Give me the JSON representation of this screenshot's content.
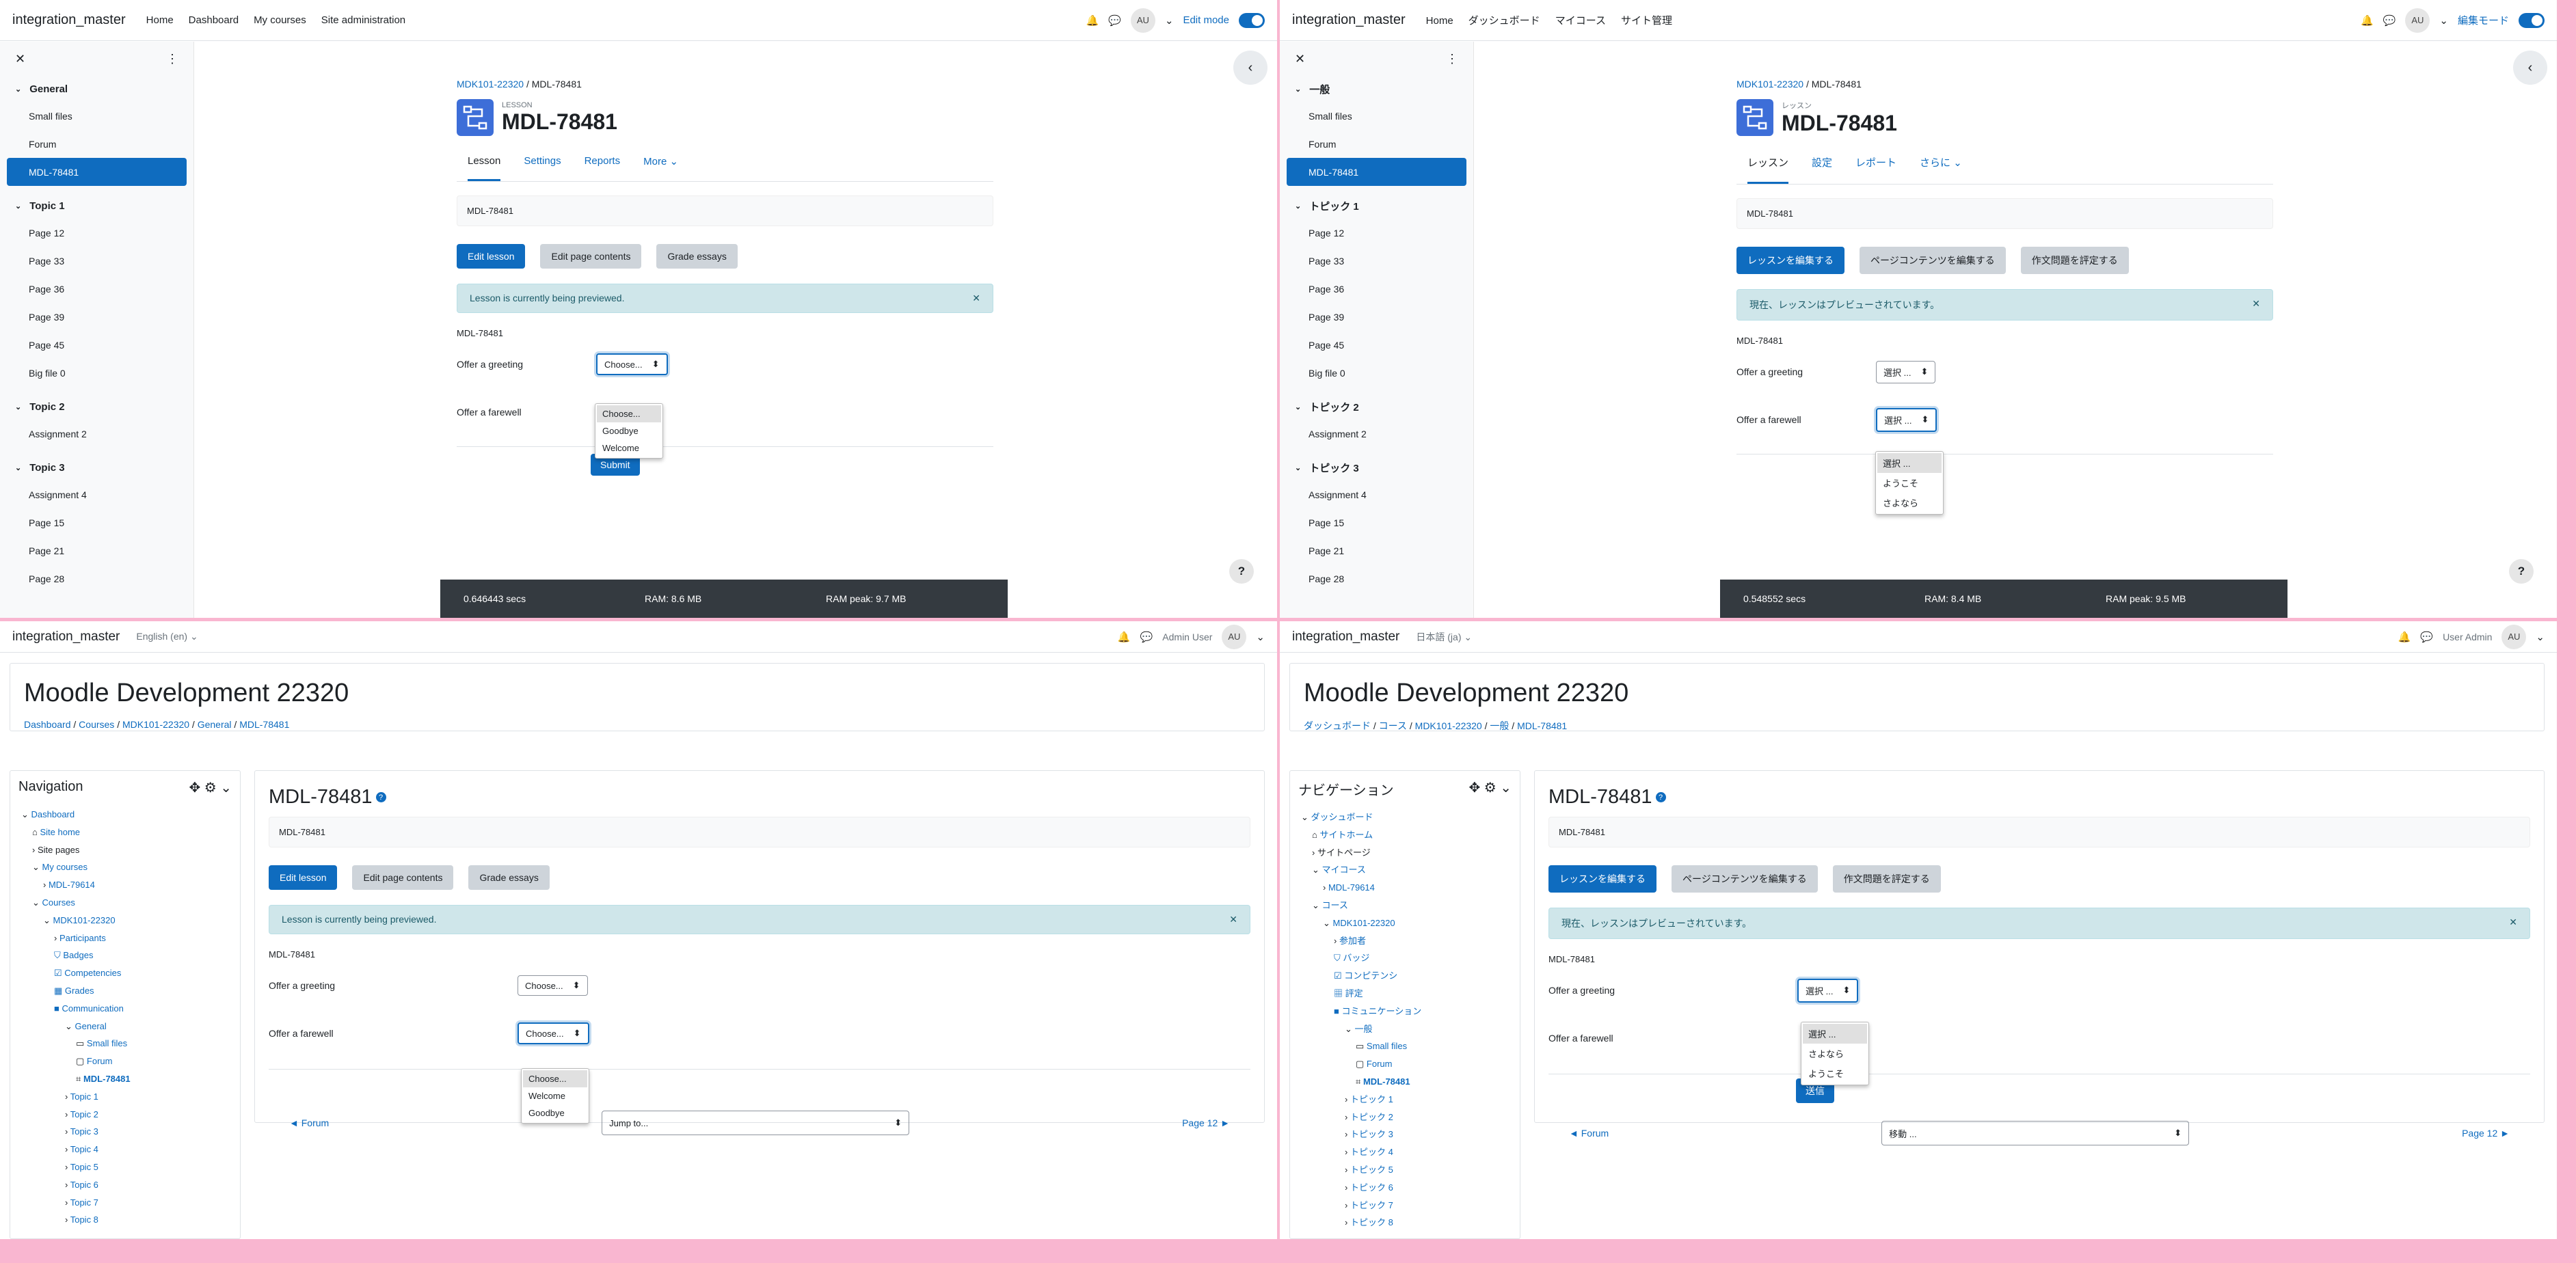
{
  "tl": {
    "brand": "integration_master",
    "nav": [
      "Home",
      "Dashboard",
      "My courses",
      "Site administration"
    ],
    "avatar": "AU",
    "editmode": "Edit mode",
    "drawer": {
      "sections": [
        {
          "title": "General",
          "items": [
            "Small files",
            "Forum",
            "MDL-78481"
          ]
        },
        {
          "title": "Topic 1",
          "items": [
            "Page 12",
            "Page 33",
            "Page 36",
            "Page 39",
            "Page 45",
            "Big file 0"
          ]
        },
        {
          "title": "Topic 2",
          "items": [
            "Assignment 2"
          ]
        },
        {
          "title": "Topic 3",
          "items": [
            "Assignment 4",
            "Page 15",
            "Page 21",
            "Page 28"
          ]
        }
      ],
      "active": "MDL-78481"
    },
    "bc": [
      "MDK101-22320",
      "MDL-78481"
    ],
    "type": "LESSON",
    "title": "MDL-78481",
    "tabs": [
      "Lesson",
      "Settings",
      "Reports",
      "More"
    ],
    "crumb": "MDL-78481",
    "buttons": [
      "Edit lesson",
      "Edit page contents",
      "Grade essays"
    ],
    "alert": "Lesson is currently being previewed.",
    "pagetitle": "MDL-78481",
    "greet": "Offer a greeting",
    "farewell": "Offer a farewell",
    "sel1": "Choose...",
    "sel2": "Choose...",
    "opts": [
      "Choose...",
      "Goodbye",
      "Welcome"
    ],
    "submit": "Submit",
    "perf": [
      "0.646443 secs",
      "RAM: 8.6 MB",
      "RAM peak: 9.7 MB"
    ]
  },
  "tr": {
    "brand": "integration_master",
    "nav": [
      "Home",
      "ダッシュボード",
      "マイコース",
      "サイト管理"
    ],
    "avatar": "AU",
    "editmode": "編集モード",
    "drawer": {
      "sections": [
        {
          "title": "一般",
          "items": [
            "Small files",
            "Forum",
            "MDL-78481"
          ]
        },
        {
          "title": "トピック 1",
          "items": [
            "Page 12",
            "Page 33",
            "Page 36",
            "Page 39",
            "Page 45",
            "Big file 0"
          ]
        },
        {
          "title": "トピック 2",
          "items": [
            "Assignment 2"
          ]
        },
        {
          "title": "トピック 3",
          "items": [
            "Assignment 4",
            "Page 15",
            "Page 21",
            "Page 28"
          ]
        }
      ],
      "active": "MDL-78481"
    },
    "bc": [
      "MDK101-22320",
      "MDL-78481"
    ],
    "type": "レッスン",
    "title": "MDL-78481",
    "tabs": [
      "レッスン",
      "設定",
      "レポート",
      "さらに"
    ],
    "crumb": "MDL-78481",
    "buttons": [
      "レッスンを編集する",
      "ページコンテンツを編集する",
      "作文問題を評定する"
    ],
    "alert": "現在、レッスンはプレビューされています。",
    "pagetitle": "MDL-78481",
    "greet": "Offer a greeting",
    "farewell": "Offer a farewell",
    "sel1": "選択 ...",
    "sel2": "選択 ...",
    "opts": [
      "選択 ...",
      "ようこそ",
      "さよなら"
    ],
    "perf": [
      "0.548552 secs",
      "RAM: 8.4 MB",
      "RAM peak: 9.5 MB"
    ]
  },
  "bl": {
    "brand": "integration_master",
    "lang": "English (en)",
    "user": "Admin User",
    "avatar": "AU",
    "site": "Moodle Development 22320",
    "bc": [
      "Dashboard",
      "Courses",
      "MDK101-22320",
      "General",
      "MDL-78481"
    ],
    "navtitle": "Navigation",
    "tree": [
      "Dashboard",
      "Site home",
      "Site pages",
      "My courses",
      "MDL-79614",
      "Courses",
      "MDK101-22320",
      "Participants",
      "Badges",
      "Competencies",
      "Grades",
      "Communication",
      "General",
      "Small files",
      "Forum",
      "MDL-78481",
      "Topic 1",
      "Topic 2",
      "Topic 3",
      "Topic 4",
      "Topic 5",
      "Topic 6",
      "Topic 7",
      "Topic 8"
    ],
    "title": "MDL-78481",
    "crumb": "MDL-78481",
    "buttons": [
      "Edit lesson",
      "Edit page contents",
      "Grade essays"
    ],
    "alert": "Lesson is currently being previewed.",
    "pagetitle": "MDL-78481",
    "greet": "Offer a greeting",
    "farewell": "Offer a farewell",
    "sel1": "Choose...",
    "sel2": "Choose...",
    "opts": [
      "Choose...",
      "Welcome",
      "Goodbye"
    ],
    "prev": "◄ Forum",
    "jump": "Jump to...",
    "next": "Page 12 ►"
  },
  "br": {
    "brand": "integration_master",
    "lang": "日本語 (ja)",
    "user": "User Admin",
    "avatar": "AU",
    "site": "Moodle Development 22320",
    "bc": [
      "ダッシュボード",
      "コース",
      "MDK101-22320",
      "一般",
      "MDL-78481"
    ],
    "navtitle": "ナビゲーション",
    "tree": [
      "ダッシュボード",
      "サイトホーム",
      "サイトページ",
      "マイコース",
      "MDL-79614",
      "コース",
      "MDK101-22320",
      "参加者",
      "バッジ",
      "コンピテンシ",
      "評定",
      "コミュニケーション",
      "一般",
      "Small files",
      "Forum",
      "MDL-78481",
      "トピック 1",
      "トピック 2",
      "トピック 3",
      "トピック 4",
      "トピック 5",
      "トピック 6",
      "トピック 7",
      "トピック 8"
    ],
    "title": "MDL-78481",
    "crumb": "MDL-78481",
    "buttons": [
      "レッスンを編集する",
      "ページコンテンツを編集する",
      "作文問題を評定する"
    ],
    "alert": "現在、レッスンはプレビューされています。",
    "pagetitle": "MDL-78481",
    "greet": "Offer a greeting",
    "farewell": "Offer a farewell",
    "sel1": "選択 ...",
    "opts": [
      "選択 ...",
      "さよなら",
      "ようこそ"
    ],
    "submit": "送信",
    "prev": "◄ Forum",
    "jump": "移動 ...",
    "next": "Page 12 ►"
  },
  "colors": {
    "primary": "#0f6cbf",
    "alert_bg": "#cfe6ea",
    "perf_bg": "#343a40",
    "separator": "#f9b6d0"
  }
}
